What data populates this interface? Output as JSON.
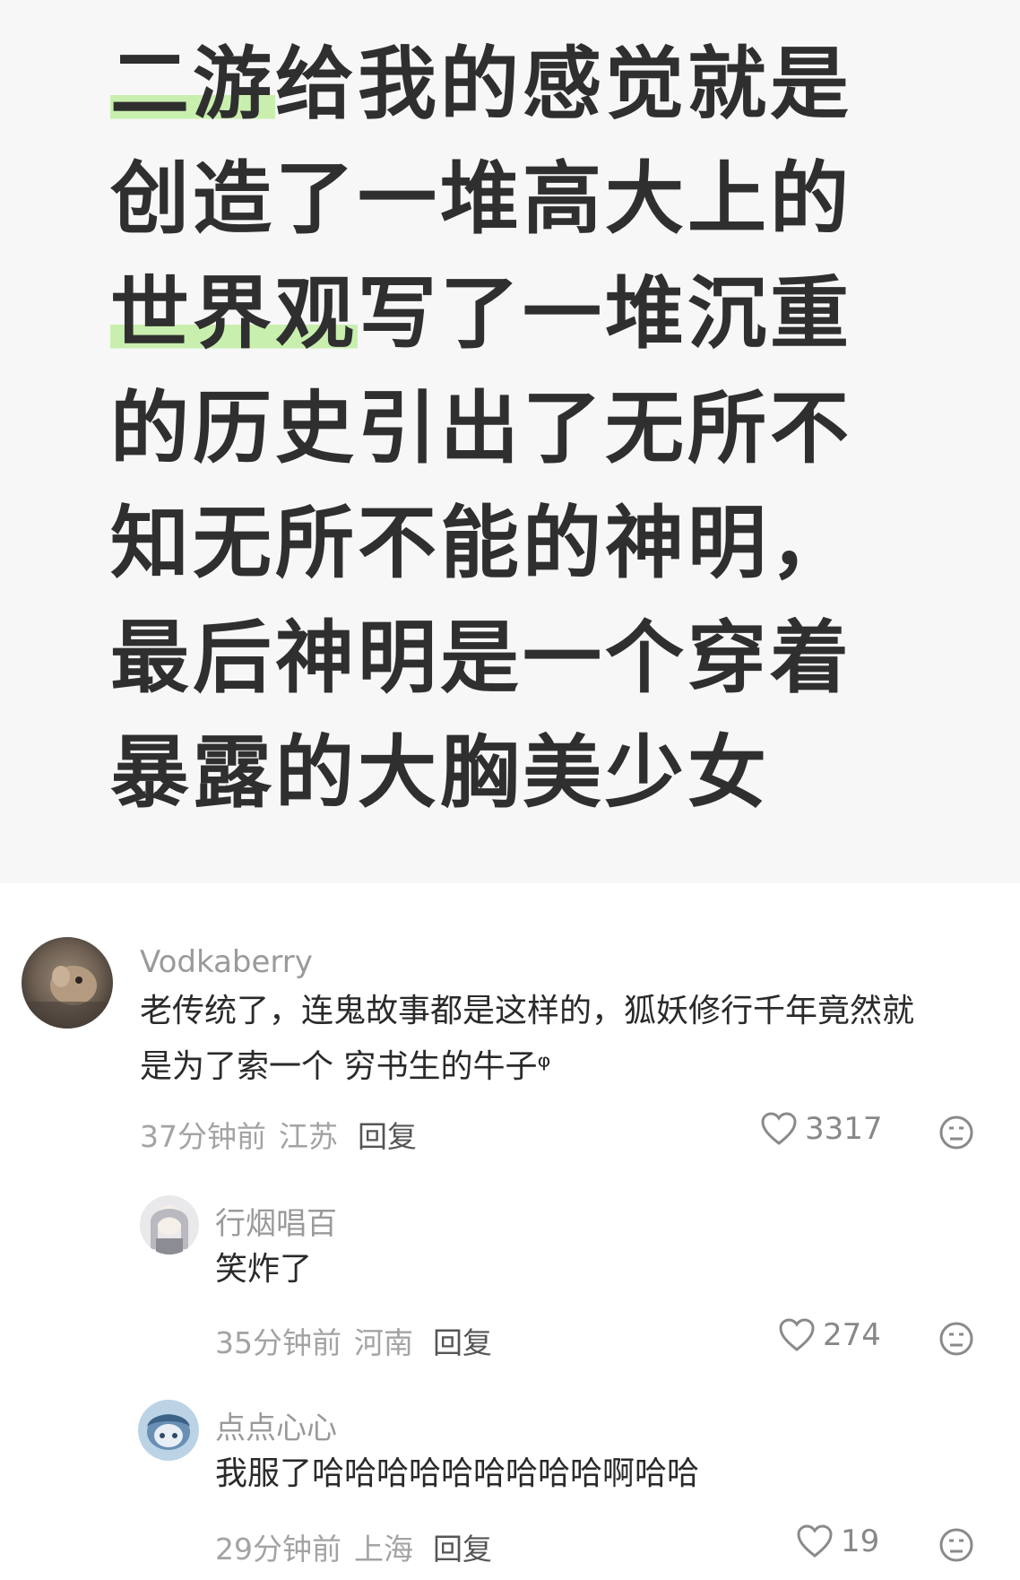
{
  "post": {
    "lines": [
      {
        "hl": "二游",
        "rest": "给我的感觉就是"
      },
      {
        "hl": "",
        "rest": "创造了一堆高大上的"
      },
      {
        "hl": "世界观",
        "rest": "写了一堆沉重"
      },
      {
        "hl": "",
        "rest": "的历史引出了无所不"
      },
      {
        "hl": "",
        "rest": "知无所不能的神明，"
      },
      {
        "hl": "",
        "rest": "最后神明是一个穿着"
      },
      {
        "hl": "",
        "rest": "暴露的大胸美少女"
      }
    ]
  },
  "comments": [
    {
      "username": "Vodkaberry",
      "text_lines": [
        "老传统了，连鬼故事都是这样的，狐妖修行千年竟然就",
        "是为了索一个 穷书生的牛子ᵠ"
      ],
      "time": "37分钟前",
      "location": "江苏",
      "reply_label": "回复",
      "likes": "3317"
    },
    {
      "username": "行烟唱百",
      "text_lines": [
        "笑炸了"
      ],
      "time": "35分钟前",
      "location": "河南",
      "reply_label": "回复",
      "likes": "274"
    },
    {
      "username": "点点心心",
      "text_lines": [
        "我服了哈哈哈哈哈哈哈哈哈啊哈哈"
      ],
      "time": "29分钟前",
      "location": "上海",
      "reply_label": "回复",
      "likes": "19"
    }
  ],
  "colors": {
    "highlight": "#c9efae",
    "post_bg": "#f7f7f7"
  }
}
